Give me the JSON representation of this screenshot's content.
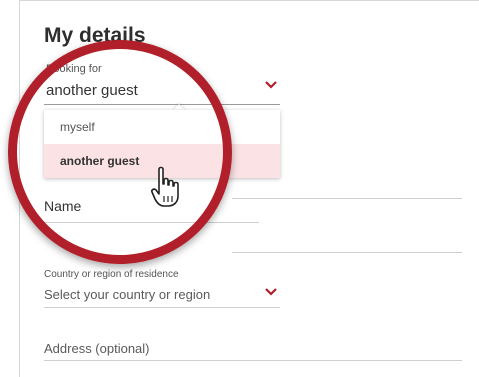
{
  "form": {
    "title": "My details",
    "booking_for": {
      "label": "Booking for",
      "value": "another guest",
      "options": [
        "myself",
        "another guest"
      ],
      "selected": "another guest"
    },
    "name_field": {
      "placeholder": "Name"
    },
    "country_field": {
      "label": "Country or region of residence",
      "placeholder": "Select your country or region"
    },
    "address_field": {
      "placeholder": "Address (optional)"
    }
  },
  "colors": {
    "accent": "#b01f2a",
    "selected_bg": "#fbe3e5",
    "divider": "#cfcfcf"
  },
  "icons": {
    "dropdown": "chevron-down-icon",
    "pointer": "hand-pointer-icon"
  }
}
